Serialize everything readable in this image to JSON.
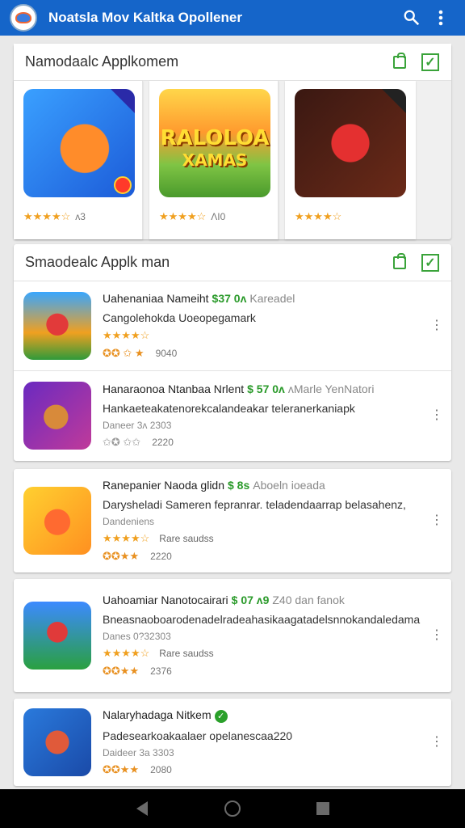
{
  "appbar": {
    "title": "Noatsla Mov Kaltka Opollener",
    "logo_icon": "app-logo-icon",
    "search_icon": "search-icon",
    "menu_icon": "more-vert-icon"
  },
  "featured": {
    "title": "Namodaalc Applkomem",
    "bag_icon": "shopping-bag-icon",
    "check_icon": "checkbox-icon",
    "check_glyph": "✓",
    "items": [
      {
        "stars": "★★★★☆",
        "count": "ᴧ3"
      },
      {
        "stars": "★★★★☆",
        "count": "ɅI0",
        "banner": "RALOLOA",
        "banner2": "XAMAS"
      },
      {
        "stars": "★★★★☆",
        "count": ""
      }
    ]
  },
  "list_section": {
    "title": "Smaodealc Applk man"
  },
  "items": [
    {
      "name": "Uahenaniaa Nameiht",
      "price": "$37 0ʌ",
      "publisher": "Kareadel",
      "desc": "Cangolehokda Uoeopegamark",
      "stars": "★★★★☆",
      "rating_glyphs": "✪✪ ✩ ★",
      "count": "9040"
    },
    {
      "name": "Hanaraonoa Ntanbaa Nrlent",
      "price": "$ 57 0ʌ",
      "publisher": "ʌMarle YenNatori",
      "desc": "Hankaeteakatenorekcalandeakar teleranerkaniapk",
      "sub": "Daneer 3ʌ 2303",
      "rating_glyphs": "✩✪ ✩✩",
      "count": "2220"
    },
    {
      "name": "Ranepanier Naoda glidn",
      "price": "$ 8s",
      "publisher": "Aboeln ioeada",
      "desc": "Darysheladi Sameren fepranrar. teladendaarrap belasahenz,",
      "sub": "Dandeniens",
      "stars": "★★★★☆",
      "stars_label": "Rare saudss",
      "rating_glyphs": "✪✪★★",
      "count": "2220"
    },
    {
      "name": "Uahoamiar Nanotocairari",
      "price": "$ 07 ʌ9",
      "publisher": "Z40 dan fanok",
      "desc": "Bneasnaoboarodenadelradeahasikaagatadelsnnokandaledama",
      "sub": "Danes 0?32303",
      "stars": "★★★★☆",
      "stars_label": "Rare saudss",
      "rating_glyphs": "✪✪★★",
      "count": "2376"
    },
    {
      "name": "Nalaryhadaga Nitkem",
      "desc": "Padesearkoakaalaer  opelanescaa220",
      "sub": "Daideer 3a 3303",
      "rating_glyphs": "✪✪★★",
      "count": "2080"
    }
  ],
  "navbar": {
    "back_icon": "back-triangle-icon",
    "home_icon": "home-circle-icon",
    "recents_icon": "recents-square-icon"
  }
}
